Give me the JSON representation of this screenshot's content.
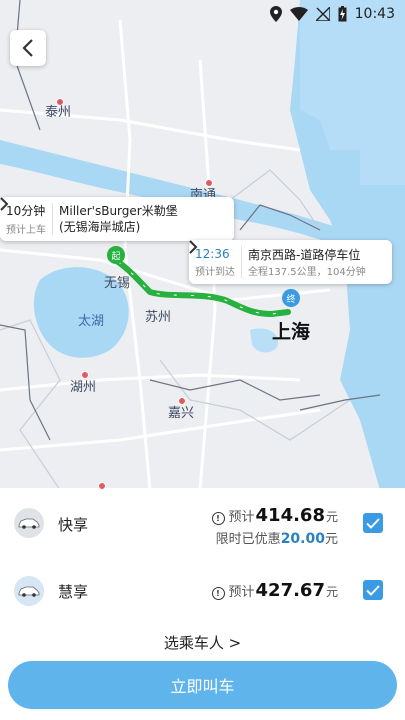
{
  "status_bar": {
    "time": "10:43"
  },
  "map": {
    "cities": [
      {
        "name": "泰州"
      },
      {
        "name": "南通"
      },
      {
        "name": "无锡"
      },
      {
        "name": "苏州"
      },
      {
        "name": "太湖"
      },
      {
        "name": "上海"
      },
      {
        "name": "湖州"
      },
      {
        "name": "嘉兴"
      }
    ],
    "start_marker": "起",
    "end_marker": "终",
    "pickup_bubble": {
      "eta": "10分钟",
      "eta_label": "预计上车",
      "place": "Miller'sBurger米勒堡(无锡海岸城店)"
    },
    "destination_bubble": {
      "arrival": "12:36",
      "arrival_label": "预计到达",
      "place": "南京西路-道路停车位",
      "summary": "全程137.5公里，104分钟"
    }
  },
  "options": [
    {
      "name": "快享",
      "price_prefix": "预计",
      "price": "414.68",
      "unit": "元",
      "discount_prefix": "限时已优惠",
      "discount": "20.00",
      "discount_unit": "元",
      "checked": true
    },
    {
      "name": "慧享",
      "price_prefix": "预计",
      "price": "427.67",
      "unit": "元",
      "checked": true
    }
  ],
  "select_passenger": "选乘车人 >",
  "call_button": "立即叫车",
  "colors": {
    "route": "#27b13f",
    "accent": "#3a9ae4",
    "button": "#60b4ec",
    "water": "#a9d8f5"
  }
}
